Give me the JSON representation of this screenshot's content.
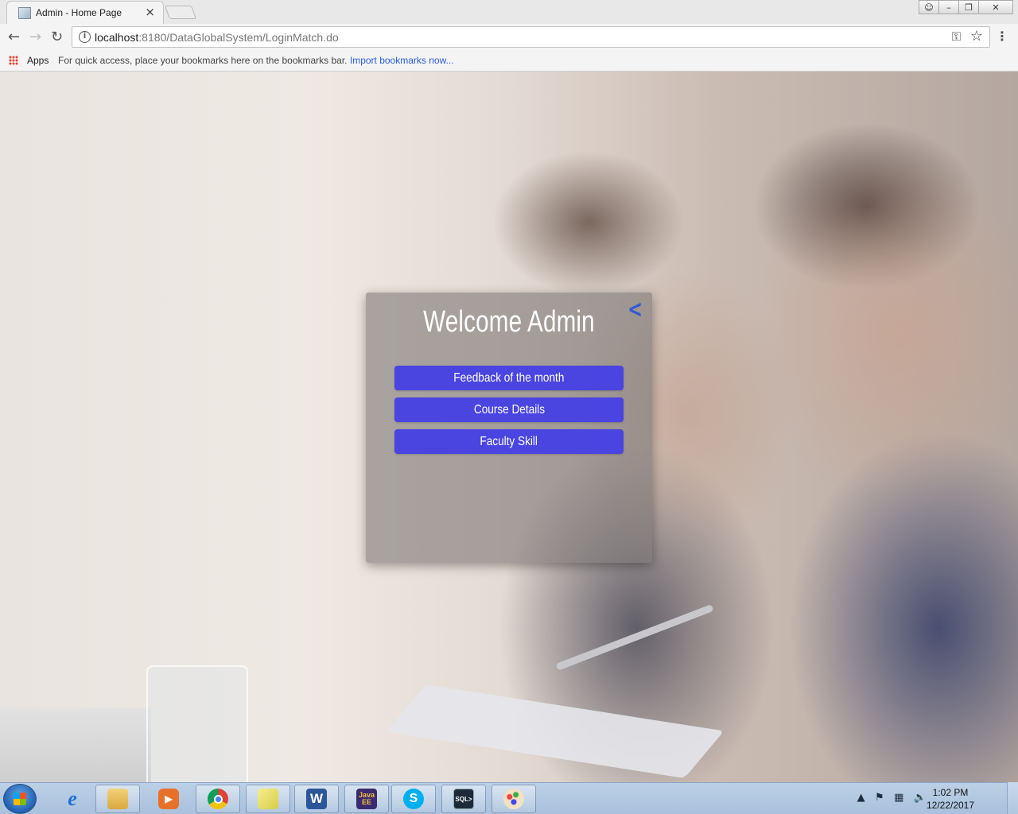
{
  "browser": {
    "tab_title": "Admin - Home Page",
    "tab_close": "×",
    "url_host": "localhost",
    "url_rest": ":8180/DataGlobalSystem/LoginMatch.do",
    "bookmarks": {
      "apps_label": "Apps",
      "hint": "For quick access, place your bookmarks here on the bookmarks bar.",
      "import_link": "Import bookmarks now..."
    }
  },
  "page": {
    "title": "Welcome Admin",
    "back_icon": "chevron-left-icon",
    "buttons": [
      {
        "label": "Feedback of the month"
      },
      {
        "label": "Course Details"
      },
      {
        "label": "Faculty Skill"
      }
    ],
    "button_color": "#4a44e0"
  },
  "taskbar": {
    "items": [
      {
        "name": "internet-explorer-icon"
      },
      {
        "name": "file-explorer-icon"
      },
      {
        "name": "media-player-icon"
      },
      {
        "name": "chrome-icon"
      },
      {
        "name": "sticky-notes-icon"
      },
      {
        "name": "word-icon"
      },
      {
        "name": "java-ee-ide-icon"
      },
      {
        "name": "skype-icon"
      },
      {
        "name": "sql-plus-icon"
      },
      {
        "name": "paint-icon"
      }
    ],
    "time": "1:02 PM",
    "date": "12/22/2017"
  }
}
